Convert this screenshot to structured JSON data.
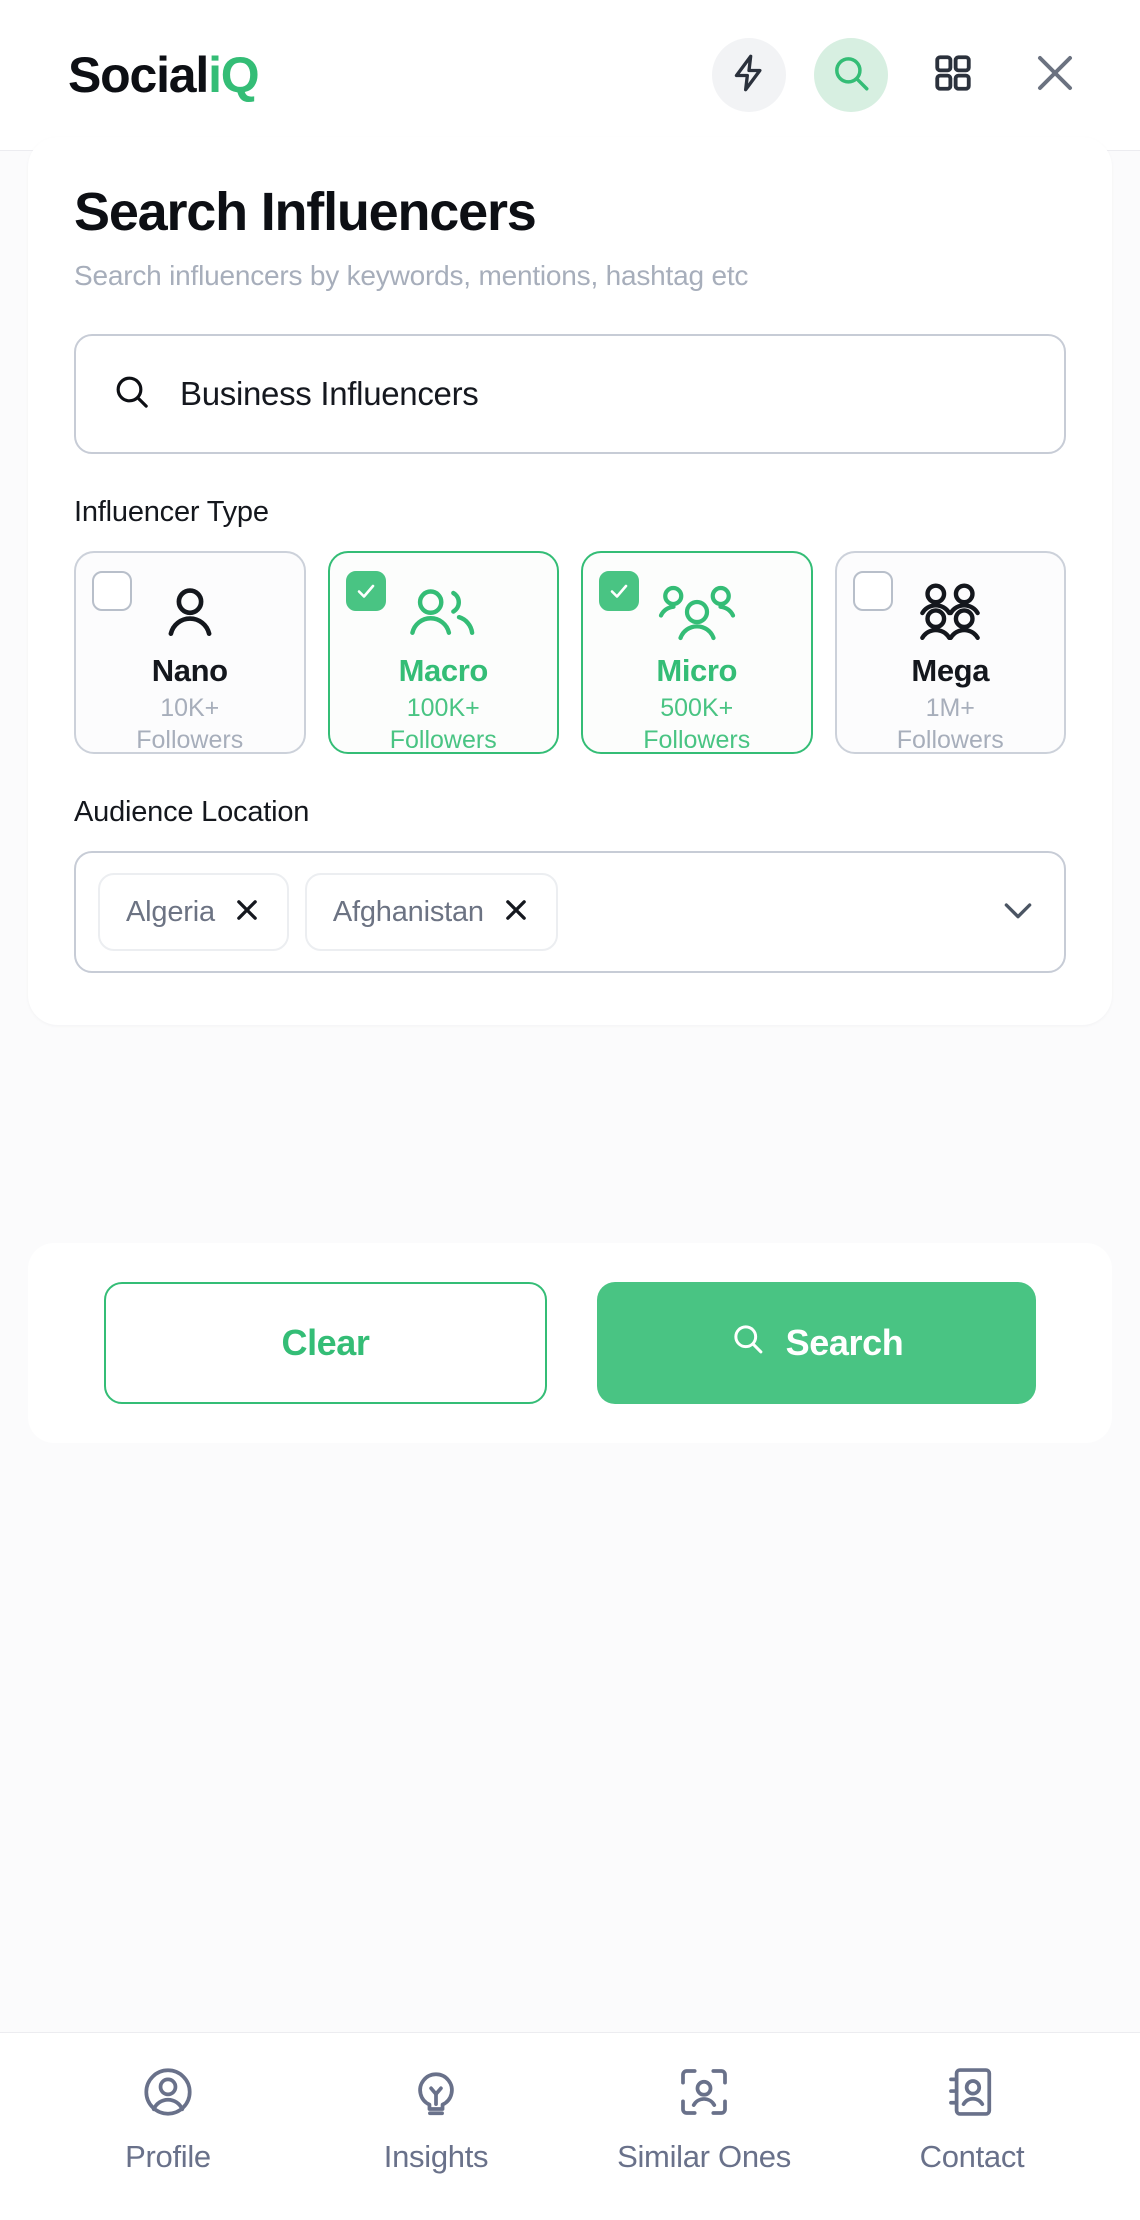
{
  "colors": {
    "brand_green": "#34bd76",
    "accent_green": "#49c483",
    "checkbox_green": "#49c483",
    "text_dark": "#0d0f14",
    "text_muted": "#a7aebb",
    "border_grey": "#c7ccd6",
    "nav_text": "#69718a",
    "icon_dark": "#2b313c",
    "close_grey": "#6b7280",
    "header_icon_bg_grey": "#f2f3f5",
    "header_icon_bg_green": "#d7efe1",
    "page_bg": "#fbfbfc",
    "card_bg": "#ffffff"
  },
  "header": {
    "brand_prefix": "Social",
    "brand_accent": "iQ",
    "icons": [
      {
        "name": "lightning-bolt-icon",
        "label": "Quick Actions",
        "style": "grey-circle",
        "active": false
      },
      {
        "name": "search-icon",
        "label": "Search",
        "style": "green-circle",
        "active": true
      },
      {
        "name": "grid-apps-icon",
        "label": "Apps",
        "style": "plain-dark",
        "active": false
      },
      {
        "name": "close-icon",
        "label": "Close",
        "style": "plain-grey",
        "active": false
      }
    ]
  },
  "main": {
    "title": "Search Influencers",
    "subtitle": "Search influencers by keywords, mentions, hashtag etc",
    "search": {
      "icon": "search-icon",
      "value": "Business Influencers",
      "placeholder": "Search influencers by keywords, mentions, hashtag etc"
    },
    "influencer_type": {
      "label": "Influencer Type",
      "options": [
        {
          "name": "Nano",
          "followers_line1": "10K+",
          "followers_line2": "Followers",
          "selected": false,
          "icon": "single-person-icon"
        },
        {
          "name": "Macro",
          "followers_line1": "100K+",
          "followers_line2": "Followers",
          "selected": true,
          "icon": "two-people-icon"
        },
        {
          "name": "Micro",
          "followers_line1": "500K+",
          "followers_line2": "Followers",
          "selected": true,
          "icon": "three-people-icon"
        },
        {
          "name": "Mega",
          "followers_line1": "1M+",
          "followers_line2": "Followers",
          "selected": false,
          "icon": "four-people-icon"
        }
      ]
    },
    "audience_location": {
      "label": "Audience Location",
      "chips": [
        {
          "label": "Algeria",
          "remove_icon": "close-icon"
        },
        {
          "label": "Afghanistan",
          "remove_icon": "close-icon"
        }
      ],
      "dropdown_icon": "chevron-down-icon"
    }
  },
  "actions": {
    "clear_label": "Clear",
    "search_label": "Search",
    "search_icon": "search-icon"
  },
  "bottom_nav": {
    "items": [
      {
        "label": "Profile",
        "icon": "user-circle-icon"
      },
      {
        "label": "Insights",
        "icon": "lightbulb-icon"
      },
      {
        "label": "Similar Ones",
        "icon": "person-scan-icon"
      },
      {
        "label": "Contact",
        "icon": "contact-book-icon"
      }
    ]
  }
}
